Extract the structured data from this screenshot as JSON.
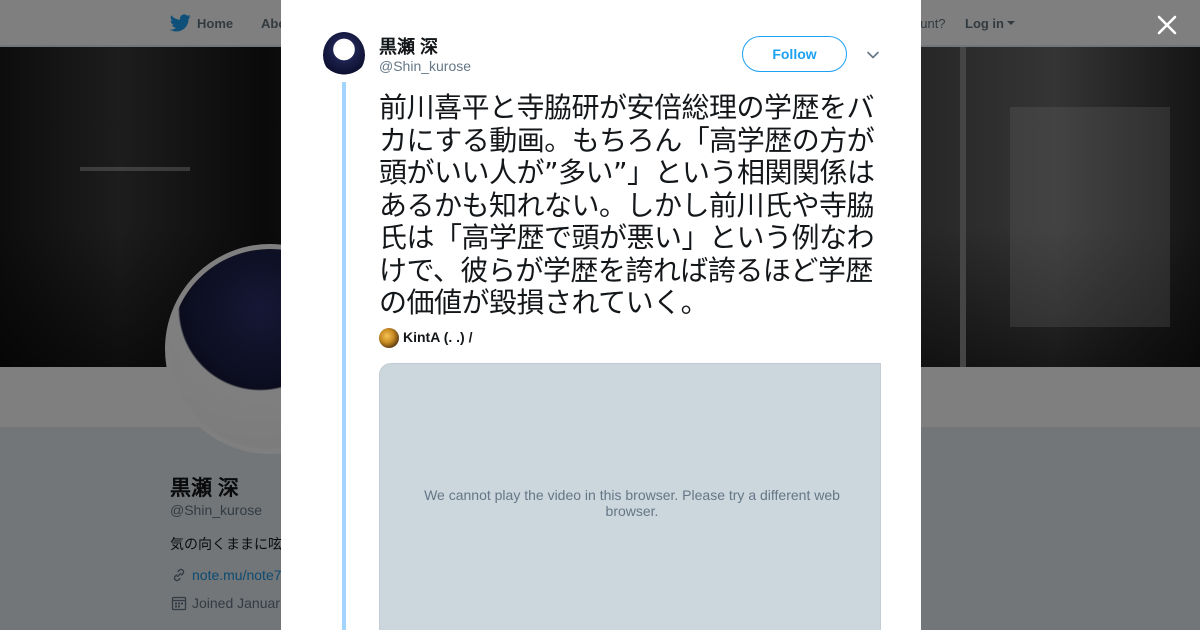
{
  "background_page": {
    "topbar": {
      "home_label": "Home",
      "about_label": "Abo",
      "account_text": "ccount?",
      "login_label": "Log in"
    },
    "profile": {
      "name": "黒瀬 深",
      "handle": "@Shin_kurose",
      "bio": "気の向くままに呟",
      "link": "note.mu/note7",
      "joined": "Joined Januar"
    }
  },
  "modal": {
    "close_icon": "close-icon",
    "author": {
      "name": "黒瀬 深",
      "handle": "@Shin_kurose"
    },
    "follow_label": "Follow",
    "tweet_text": "前川喜平と寺脇研が安倍総理の学歴をバカにする動画。もちろん「高学歴の方が頭がいい人が”多い”」という相関関係はあるかも知れない。しかし前川氏や寺脇氏は「高学歴で頭が悪い」という例なわけで、彼らが学歴を誇れば誇るほど学歴の価値が毀損されていく。",
    "quoted": {
      "name": "KintA (. .) /"
    },
    "video_message": "We cannot play the video in this browser. Please try a different web browser."
  },
  "colors": {
    "accent": "#1da1f2",
    "thread_line": "#a3d3ff",
    "video_bg": "#ccd6dd",
    "overlay": "rgba(0,0,0,0.5)"
  }
}
